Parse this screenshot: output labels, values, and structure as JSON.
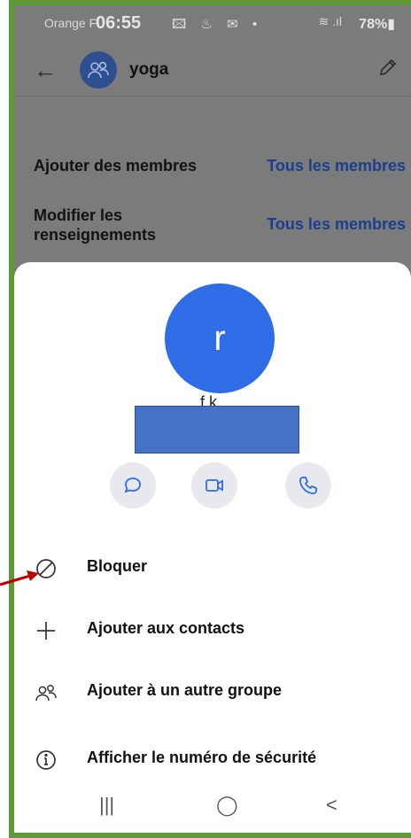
{
  "status_bar": {
    "carrier": "Orange F",
    "time": "06:55",
    "icons_left": "🖾 ♨ ✉ •",
    "signal": "≋ .ıl",
    "battery": "78%▮"
  },
  "app_bar": {
    "back_icon": "arrow-left",
    "group_name": "yoga",
    "edit_icon": "pencil"
  },
  "settings": [
    {
      "label": "Ajouter des membres",
      "value": "Tous les membres"
    },
    {
      "label": "Modifier les renseignements",
      "value": "Tous les membres"
    }
  ],
  "contact_sheet": {
    "avatar_letter": "r",
    "name_visible_fragment": "f  k",
    "actions": [
      {
        "icon": "message-icon"
      },
      {
        "icon": "video-icon"
      },
      {
        "icon": "phone-icon"
      }
    ],
    "menu": [
      {
        "icon": "block-icon",
        "label": "Bloquer"
      },
      {
        "icon": "plus-icon",
        "label": "Ajouter aux contacts"
      },
      {
        "icon": "group-icon",
        "label": "Ajouter à un autre groupe"
      },
      {
        "icon": "info-icon",
        "label": "Afficher le numéro de sécurité"
      }
    ]
  },
  "nav_bar": {
    "recents": "|||",
    "home": "◯",
    "back": "<"
  },
  "colors": {
    "accent_blue": "#2e6de6",
    "link_blue": "#1a3f8f",
    "frame_green": "#5f9a3a",
    "annotation_red": "#c00000"
  }
}
